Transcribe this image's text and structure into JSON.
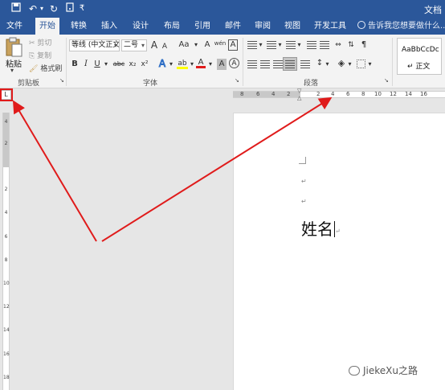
{
  "quick_access": {
    "save_icon": "save-icon",
    "undo_icon": "undo-icon",
    "redo_icon": "redo-icon",
    "touch_icon": "touch-mode-icon",
    "customize_symbol": "₹",
    "title_fragment": "文档"
  },
  "tabs": [
    {
      "label": "文件",
      "active": false
    },
    {
      "label": "开始",
      "active": true
    },
    {
      "label": "转换",
      "active": false
    },
    {
      "label": "插入",
      "active": false
    },
    {
      "label": "设计",
      "active": false
    },
    {
      "label": "布局",
      "active": false
    },
    {
      "label": "引用",
      "active": false
    },
    {
      "label": "邮件",
      "active": false
    },
    {
      "label": "审阅",
      "active": false
    },
    {
      "label": "视图",
      "active": false
    },
    {
      "label": "开发工具",
      "active": false
    }
  ],
  "tell_me": "告诉我您想要做什么...",
  "clipboard": {
    "paste_label": "粘贴",
    "cut_label": "剪切",
    "copy_label": "复制",
    "format_painter_label": "格式刷",
    "group_label": "剪贴板"
  },
  "font": {
    "font_name": "等线 (中文正文)",
    "font_size": "二号",
    "grow": "A",
    "shrink": "A",
    "case_label": "Aa",
    "clear_format": "A",
    "phonetic": "wén",
    "char_border": "A",
    "bold": "B",
    "italic": "I",
    "underline": "U",
    "strike": "abc",
    "subscript": "x₂",
    "superscript": "x²",
    "effects": "A",
    "highlight": "ab",
    "font_color": "A",
    "char_shading": "A",
    "enclose": "A",
    "group_label": "字体"
  },
  "paragraph": {
    "group_label": "段落"
  },
  "styles": {
    "preview": "AaBbCcDc",
    "name": "正文",
    "marker": "↵"
  },
  "horizontal_ruler": {
    "left_numbers": [
      "8",
      "6",
      "4",
      "2"
    ],
    "right_numbers": [
      "2",
      "4",
      "6",
      "8",
      "10",
      "12",
      "14",
      "16"
    ]
  },
  "vertical_ruler": {
    "numbers": [
      "4",
      "2",
      "2",
      "4",
      "6",
      "8",
      "10",
      "12",
      "14",
      "16",
      "18"
    ]
  },
  "tab_selector": "L",
  "document": {
    "para_mark": "↵",
    "text": "姓名"
  },
  "watermark": "JiekeXu之路",
  "colors": {
    "accent": "#2b579a",
    "annotation": "#e01b1b",
    "highlight_yellow": "#ffff00",
    "font_red": "#e01b1b"
  }
}
